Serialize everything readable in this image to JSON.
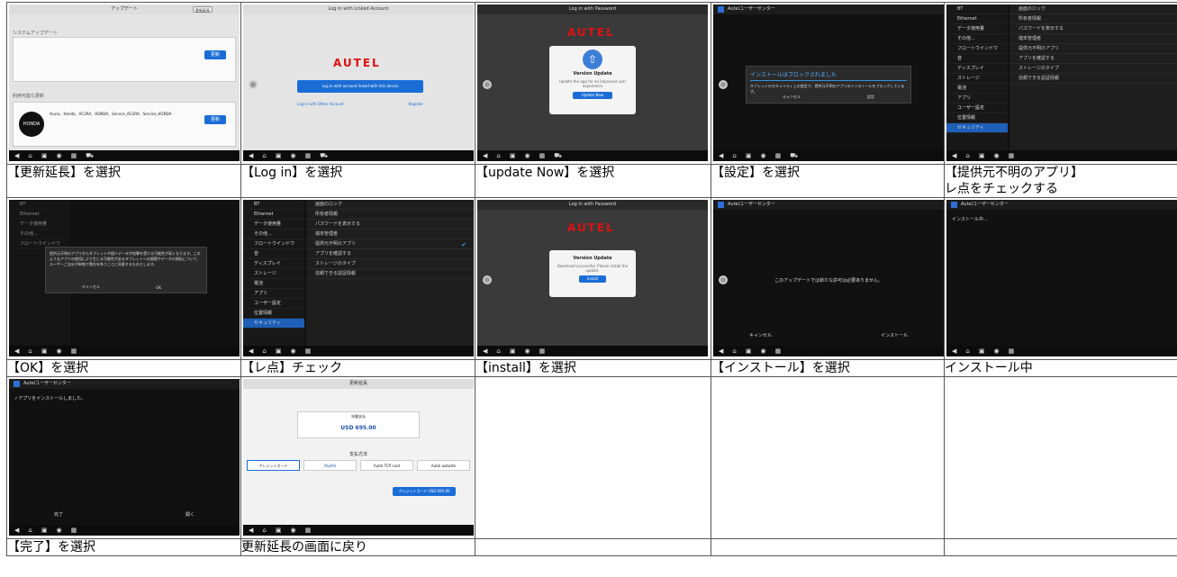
{
  "captions": [
    "【更新延長】を選択",
    "【Log in】を選択",
    "【update Now】を選択",
    "【設定】を選択",
    "【提供元不明のアプリ】\nレ点をチェックする",
    "【OK】を選択",
    "【レ点】チェック",
    "【install】を選択",
    "【インストール】を選択",
    "インストール中",
    "【完了】を選択",
    "更新延長の画面に戻り"
  ],
  "shots": {
    "s1": {
      "title": "アップデート",
      "btn": "更新延長",
      "section1": "システムアップデート",
      "section2": "利用可能な更新",
      "honda": "HONDA",
      "honda_models": "Acura、Honda、ACURA、HONDA、Service_ACURA、Service_HONDA",
      "update": "更新"
    },
    "s2": {
      "title": "Log in with Linked Account",
      "autel": "AUTEL",
      "login": "Log in with account linked with this device",
      "other": "Log in with Other Account",
      "register": "Register"
    },
    "s3": {
      "title": "Log in with Password",
      "autel": "AUTEL",
      "heading": "Version Update",
      "body": "Update the app for an improved user experience",
      "btn": "Update Now"
    },
    "s4": {
      "title": "Autelユーザーセンター",
      "dlg_title": "インストールはブロックされました",
      "dlg_body": "タブレットのセキュリティ上の設定で、提供元不明のアプリのインストールをブロックしています。",
      "cancel": "キャンセル",
      "settings": "設定"
    },
    "s5": {
      "title": "セキュリティ",
      "side": [
        "BT",
        "Ethernet",
        "データ使用量",
        "その他...",
        "フロートウインドウ",
        "音",
        "ディスプレイ",
        "ストレージ",
        "電池",
        "アプリ",
        "ユーザー設定",
        "位置情報",
        "セキュリティ"
      ],
      "right": [
        "画面のロック",
        "所有者情報",
        "パスワードを表示する",
        "端末管理者",
        "提供元不明のアプリ",
        "アプリを確認する",
        "ストレージのタイプ",
        "信頼できる認証情報"
      ]
    },
    "s6": {
      "dlg_body": "提供元不明のアプリからタブレットや個人データが攻撃を受ける可能性が高くなります。このようなアプリの使用により生じる可能性があるタブレットへの損害やデータの損失について、ユーザーご自分が単独で責任を負うことに同意するものとします。",
      "cancel": "キャンセル",
      "ok": "OK"
    },
    "s8": {
      "title": "Log in with Password",
      "autel": "AUTEL",
      "heading": "Version Update",
      "body": "Download successful. Please install the update.",
      "btn": "Install"
    },
    "s9": {
      "title": "Autelユーザーセンター",
      "msg": "このアップデートでは新たな許可は必要ありません。",
      "cancel": "キャンセル",
      "install": "インストール"
    },
    "s10": {
      "title": "Autelユーザーセンター",
      "msg": "インストール中..."
    },
    "s11": {
      "title": "Autelユーザーセンター",
      "msg": "✓アプリをインストールしました。",
      "done": "完了",
      "open": "開く"
    },
    "s12": {
      "title": "更新延長",
      "annual": "年間支払",
      "price": "USD 695.00",
      "pay": "支払方法",
      "card": "クレジットカード",
      "paypal": "PayPal",
      "tcp": "Autel TCP card",
      "web": "Autel website",
      "cta": "クレジットカード USD 695.00"
    }
  }
}
